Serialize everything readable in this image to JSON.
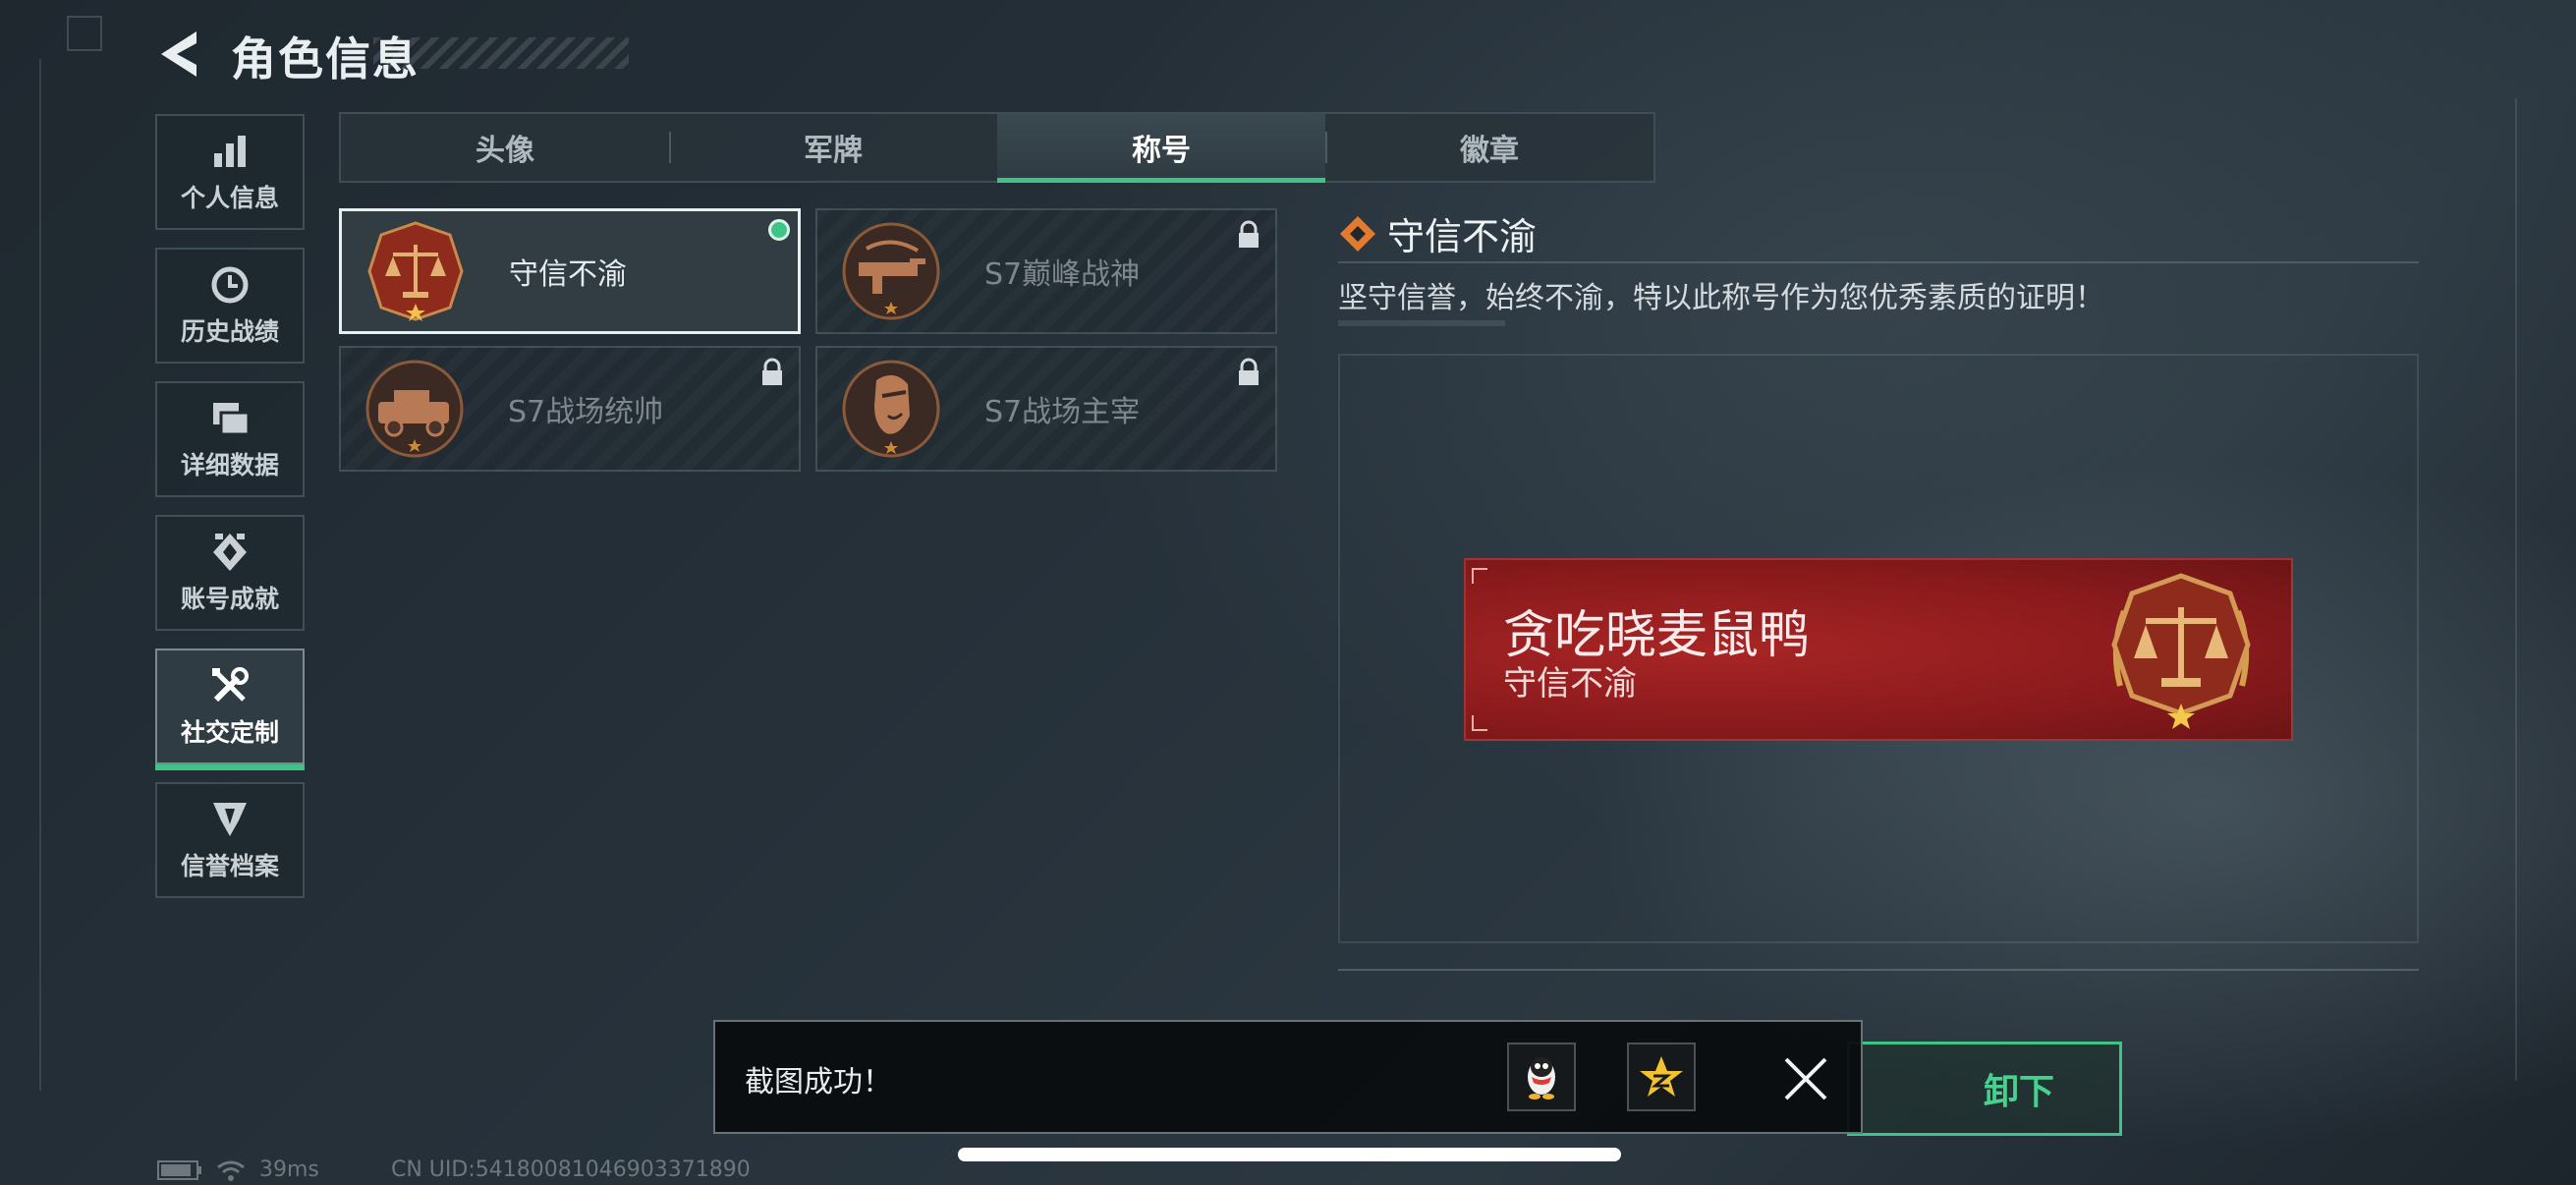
{
  "header": {
    "title": "角色信息"
  },
  "sidebar": {
    "items": [
      {
        "label": "个人信息",
        "icon": "bar-chart-icon"
      },
      {
        "label": "历史战绩",
        "icon": "clock-history-icon"
      },
      {
        "label": "详细数据",
        "icon": "folder-icon"
      },
      {
        "label": "账号成就",
        "icon": "achievement-icon"
      },
      {
        "label": "社交定制",
        "icon": "tools-icon",
        "active": true
      },
      {
        "label": "信誉档案",
        "icon": "credit-icon"
      }
    ]
  },
  "tabs": [
    {
      "label": "头像"
    },
    {
      "label": "军牌"
    },
    {
      "label": "称号",
      "active": true
    },
    {
      "label": "徽章"
    }
  ],
  "titles": [
    {
      "name": "守信不渝",
      "selected": true,
      "equipped": true,
      "locked": false
    },
    {
      "name": "S7巅峰战神",
      "selected": false,
      "locked": true
    },
    {
      "name": "S7战场统帅",
      "selected": false,
      "locked": true
    },
    {
      "name": "S7战场主宰",
      "selected": false,
      "locked": true
    }
  ],
  "detail": {
    "title": "守信不渝",
    "description": "坚守信誉，始终不渝，特以此称号作为您优秀素质的证明！"
  },
  "banner": {
    "player_name": "贪吃晓麦鼠鸭",
    "title": "守信不渝"
  },
  "action": {
    "unequip_label": "卸下"
  },
  "toast": {
    "text": "截图成功！"
  },
  "status": {
    "ping": "39ms",
    "uid": "CN UID:54180081046903371890"
  },
  "colors": {
    "accent": "#3ec487",
    "banner_red": "#a82525",
    "medal_bronze": "#b86a32"
  }
}
